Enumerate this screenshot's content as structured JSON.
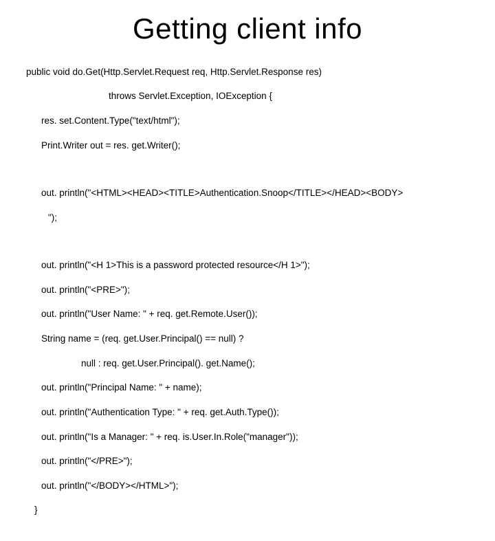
{
  "title": "Getting client info",
  "lines": {
    "l1": "public void do.Get(Http.Servlet.Request req, Http.Servlet.Response res)",
    "l2": "throws Servlet.Exception, IOException {",
    "l3": "res. set.Content.Type(\"text/html\");",
    "l4": "Print.Writer out = res. get.Writer();",
    "l5": "out. println(\"<HTML><HEAD><TITLE>Authentication.Snoop</TITLE></HEAD><BODY>",
    "l5b": "\");",
    "l6": "out. println(\"<H 1>This is a password protected resource</H 1>\");",
    "l7": "out. println(\"<PRE>\");",
    "l8": "out. println(\"User Name: \" + req. get.Remote.User());",
    "l9": "String name = (req. get.User.Principal() == null) ?",
    "l10": "null : req. get.User.Principal(). get.Name();",
    "l11": "out. println(\"Principal Name: \" + name);",
    "l12": "out. println(\"Authentication Type: \" + req. get.Auth.Type());",
    "l13": "out. println(\"Is a Manager: \" + req. is.User.In.Role(\"manager\"));",
    "l14": "out. println(\"</PRE>\");",
    "l15": "out. println(\"</BODY></HTML>\");",
    "l16": "}"
  }
}
